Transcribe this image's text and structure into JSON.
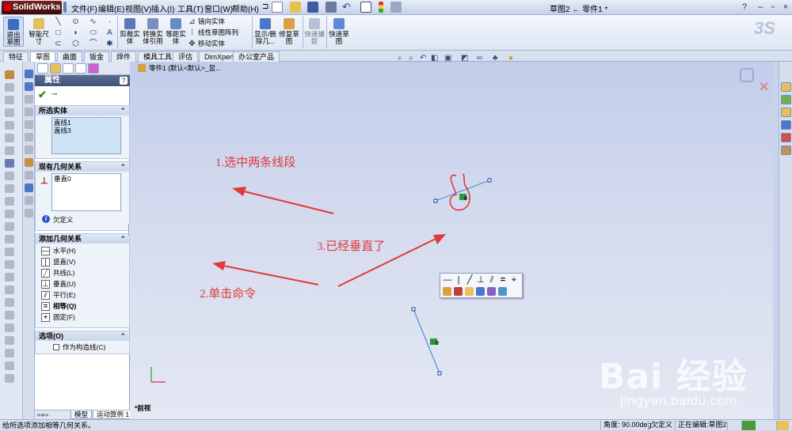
{
  "titlebar": {
    "app": "SolidWorks",
    "menus": [
      "文件(F)",
      "编辑(E)",
      "视图(V)",
      "插入(I)",
      "工具(T)",
      "窗口(W)",
      "帮助(H)"
    ],
    "doc_title": "草图2 ← 零件1 *",
    "pin": "⊐"
  },
  "commands": {
    "exit_sketch": "退出草图",
    "smart_dim": "智能尺寸",
    "trim": "剪裁实体",
    "convert": "转换实体引用",
    "offset": "等距实体",
    "mirror": "镜向实体",
    "linear_pattern": "线性草图阵列",
    "move": "移动实体",
    "show_delete": "显示/删除几...",
    "repair": "修复草图",
    "quick_snap": "快速捕捉",
    "rapid_sketch": "快速草图"
  },
  "cmd_tabs": [
    "特征",
    "草图",
    "曲面",
    "钣金",
    "焊件",
    "模具工具",
    "评估",
    "DimXpert",
    "办公室产品"
  ],
  "feature_tree": {
    "breadcrumb": "零件1  (默认<默认>_显..."
  },
  "property_manager": {
    "title": "属性",
    "selected_entities": {
      "header": "所选实体",
      "items": [
        "直线1",
        "直线3"
      ]
    },
    "existing_relations": {
      "header": "现有几何关系",
      "items": [
        "垂直0"
      ],
      "status": "欠定义"
    },
    "add_relations": {
      "header": "添加几何关系",
      "items": [
        "水平(H)",
        "竖直(V)",
        "共线(L)",
        "垂直(U)",
        "平行(E)",
        "相等(Q)",
        "固定(F)"
      ]
    },
    "options": {
      "header": "选项(O)",
      "construction": "作为构造线(C)"
    }
  },
  "bottom_tabs": [
    "模型",
    "运动算例 1"
  ],
  "view_label": "*前视",
  "relation_marker": "0",
  "annotations": {
    "a1": "1.选中两条线段",
    "a2": "2.单击命令",
    "a3": "3.已经垂直了"
  },
  "status_bar": {
    "message": "给所选项添加相等几何关系。",
    "angle": "角度:   90.00deg",
    "state": "欠定义",
    "editing": "正在编辑:草图2"
  },
  "watermark": {
    "brand": "Bai 经验",
    "url": "jingyan.baidu.com"
  },
  "colors": {
    "annotation": "#e03a3a",
    "sketch_line": "#4a90d9",
    "pm_header": "#3f5278"
  }
}
